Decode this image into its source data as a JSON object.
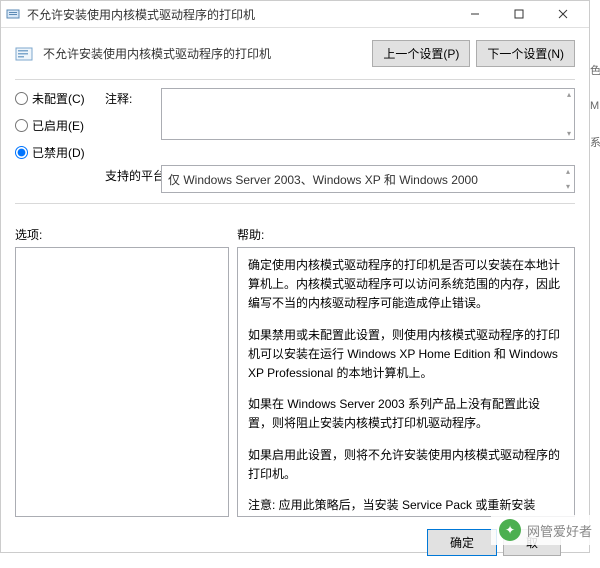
{
  "window": {
    "title": "不允许安装使用内核模式驱动程序的打印机"
  },
  "header": {
    "title": "不允许安装使用内核模式驱动程序的打印机",
    "prev_btn": "上一个设置(P)",
    "next_btn": "下一个设置(N)"
  },
  "radios": {
    "not_configured": "未配置(C)",
    "enabled": "已启用(E)",
    "disabled": "已禁用(D)",
    "selected": "disabled"
  },
  "labels": {
    "comment": "注释:",
    "platform": "支持的平台:",
    "options": "选项:",
    "help": "帮助:"
  },
  "platform_text": "仅 Windows Server 2003、Windows XP 和 Windows 2000",
  "help_paragraphs": [
    "确定使用内核模式驱动程序的打印机是否可以安装在本地计算机上。内核模式驱动程序可以访问系统范围的内存，因此编写不当的内核驱动程序可能造成停止错误。",
    "如果禁用或未配置此设置，则使用内核模式驱动程序的打印机可以安装在运行 Windows XP Home Edition 和 Windows XP Professional 的本地计算机上。",
    "如果在 Windows Server 2003 系列产品上没有配置此设置，则将阻止安装内核模式打印机驱动程序。",
    "如果启用此设置，则将不允许安装使用内核模式驱动程序的打印机。",
    "注意: 应用此策略后，当安装 Service Pack 或重新安装 Windows XP 操作系统时会禁用现有的内核模式驱动程序。此策略不适用于 64 位内核模式打印机驱动程序，因为这些驱动程序无法安装且不能与打印队列关联。"
  ],
  "buttons": {
    "ok": "确定",
    "cancel": "取"
  },
  "watermark": "网管爱好者",
  "edge": {
    "a": "色",
    "b": "M",
    "c": "系"
  }
}
